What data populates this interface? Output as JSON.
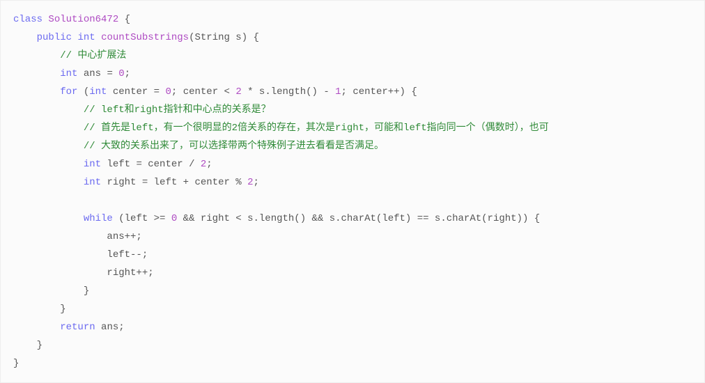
{
  "code": {
    "l1": {
      "kw_class": "class",
      "name": "Solution6472",
      "brace": " {"
    },
    "l2": {
      "kw_public": "public",
      "kw_int": "int",
      "fn": "countSubstrings",
      "sig": "(String s) {"
    },
    "l3": {
      "cmt": "// 中心扩展法"
    },
    "l4": {
      "kw_int": "int",
      "rest": " ans = ",
      "zero": "0",
      "semi": ";"
    },
    "l5": {
      "kw_for": "for",
      "p1": " (",
      "kw_int": "int",
      "p2": " center = ",
      "n0": "0",
      "p3": "; center < ",
      "n2": "2",
      "p4": " * s.length() - ",
      "n1": "1",
      "p5": "; center++) {"
    },
    "l6": {
      "cmt": "// left和right指针和中心点的关系是？"
    },
    "l7": {
      "cmt": "// 首先是left，有一个很明显的2倍关系的存在，其次是right，可能和left指向同一个（偶数时），也可"
    },
    "l8": {
      "cmt": "// 大致的关系出来了，可以选择带两个特殊例子进去看看是否满足。"
    },
    "l9": {
      "kw_int": "int",
      "rest": " left = center / ",
      "n2": "2",
      "semi": ";"
    },
    "l10": {
      "kw_int": "int",
      "rest": " right = left + center % ",
      "n2": "2",
      "semi": ";"
    },
    "l11": {
      "blank": ""
    },
    "l12": {
      "kw_while": "while",
      "rest": " (left >= ",
      "n0": "0",
      "rest2": " && right < s.length() && s.charAt(left) == s.charAt(right)) {"
    },
    "l13": {
      "txt": "ans++;"
    },
    "l14": {
      "txt": "left--;"
    },
    "l15": {
      "txt": "right++;"
    },
    "l16": {
      "txt": "}"
    },
    "l17": {
      "txt": "}"
    },
    "l18": {
      "kw_return": "return",
      "rest": " ans;"
    },
    "l19": {
      "txt": "}"
    },
    "l20": {
      "txt": "}"
    }
  }
}
